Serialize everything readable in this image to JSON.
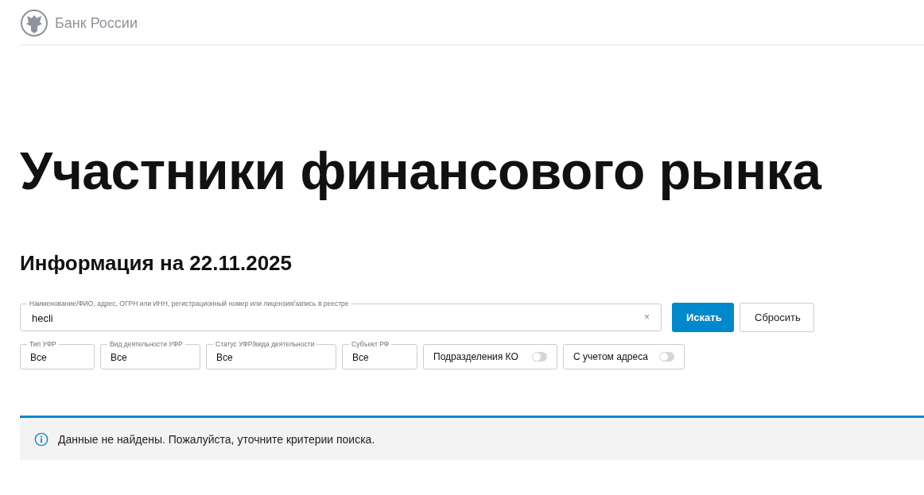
{
  "header": {
    "brand": "Банк России"
  },
  "title": "Участники финансового рынка",
  "subtitle": "Информация на 22.11.2025",
  "search": {
    "label": "Наименование/ФИО, адрес, ОГРН или ИНН, регистрационный номер или лицензия/запись в реестре",
    "value": "hecli",
    "clear": "×"
  },
  "buttons": [
    {
      "label": "Искать",
      "kind": "primary"
    },
    {
      "label": "Сбросить",
      "kind": "secondary"
    }
  ],
  "filters": [
    {
      "kind": "select",
      "label": "Тип УФР",
      "value": "Все"
    },
    {
      "kind": "select",
      "label": "Вид деятельности УФР",
      "value": "Все"
    },
    {
      "kind": "select",
      "label": "Статус УФР/вида деятельности",
      "value": "Все"
    },
    {
      "kind": "select",
      "label": "Субъект РФ",
      "value": "Все"
    },
    {
      "kind": "toggle",
      "label": "Подразделения КО",
      "on": false
    },
    {
      "kind": "toggle",
      "label": "С учетом адреса",
      "on": false
    }
  ],
  "alert": {
    "text": "Данные не найдены. Пожалуйста, уточните критерии поиска."
  }
}
